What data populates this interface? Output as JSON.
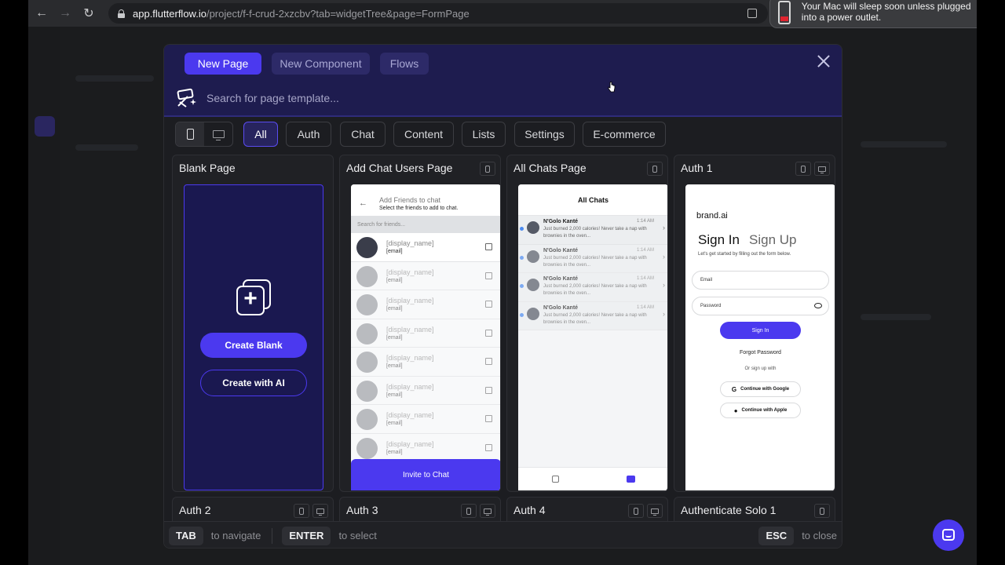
{
  "browser": {
    "url_host": "app.flutterflow.io",
    "url_path": "/project/f-f-crud-2xzcbv?tab=widgetTree&page=FormPage"
  },
  "notification": {
    "text": "Your Mac will sleep soon unless plugged into a power outlet."
  },
  "modal": {
    "tabs": [
      {
        "label": "New Page",
        "active": true
      },
      {
        "label": "New Component",
        "active": false
      },
      {
        "label": "Flows",
        "active": false
      }
    ],
    "search_placeholder": "Search for page template...",
    "filters": [
      "All",
      "Auth",
      "Chat",
      "Content",
      "Lists",
      "Settings",
      "E-commerce"
    ],
    "active_filter": "All",
    "device_active": "phone",
    "cards": [
      {
        "title": "Blank Page",
        "primary": "Create Blank",
        "secondary": "Create with AI"
      },
      {
        "title": "Add Chat Users Page",
        "header_title": "Add Friends to chat",
        "header_sub": "Select the friends to add to chat.",
        "search": "Search for friends...",
        "row_name": "[display_name]",
        "row_email": "[email]",
        "cta": "Invite to Chat"
      },
      {
        "title": "All Chats Page",
        "header": "All Chats",
        "row_name": "N'Golo Kanté",
        "row_time": "1:14 AM",
        "row_msg": "Just burned 2,000 calories! Never take a nap with brownies in the oven..."
      },
      {
        "title": "Auth 1",
        "brand": "brand.ai",
        "sign_in": "Sign In",
        "sign_up": "Sign Up",
        "desc": "Let's get started by filling out the form below.",
        "email": "Email",
        "password": "Password",
        "submit": "Sign In",
        "forgot": "Forgot Password",
        "or": "Or sign up with",
        "google": "Continue with Google",
        "apple": "Continue with Apple"
      },
      {
        "title": "Auth 2"
      },
      {
        "title": "Auth 3"
      },
      {
        "title": "Auth 4"
      },
      {
        "title": "Authenticate Solo 1"
      }
    ],
    "footer": {
      "tab_key": "TAB",
      "tab_hint": "to navigate",
      "enter_key": "ENTER",
      "enter_hint": "to select",
      "esc_key": "ESC",
      "esc_hint": "to close"
    }
  },
  "colors": {
    "accent": "#4b39ef",
    "modal_header": "#1e1c4f"
  },
  "icons": [
    "back-icon",
    "forward-icon",
    "reload-icon",
    "lock-icon",
    "battery-icon",
    "close-icon",
    "magic-search-icon",
    "phone-icon",
    "desktop-icon",
    "add-page-icon",
    "chat-support-icon"
  ]
}
